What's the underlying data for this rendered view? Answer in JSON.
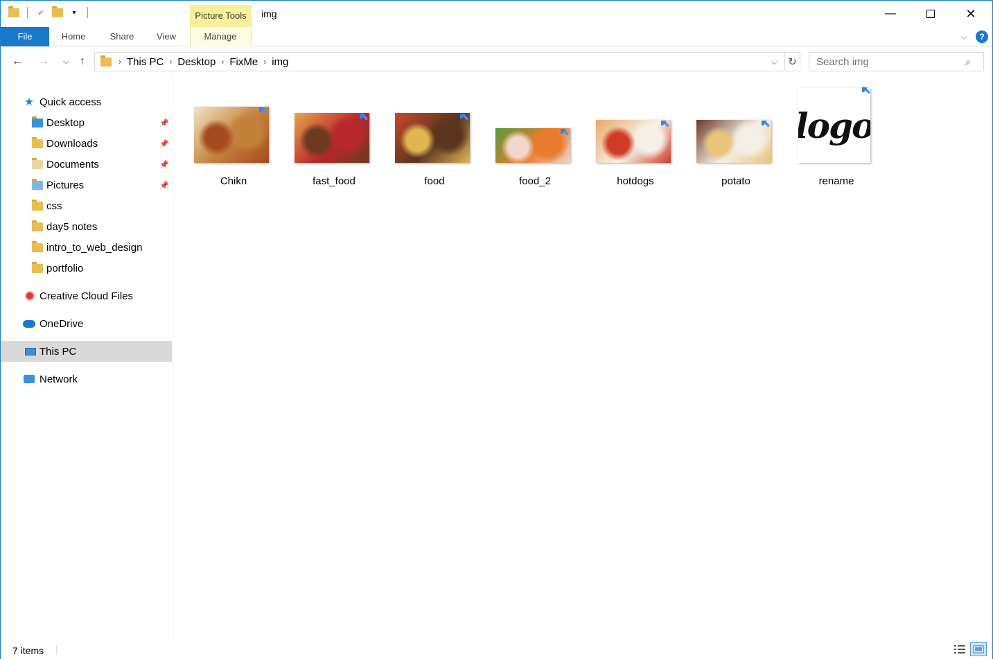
{
  "window": {
    "title": "img",
    "contextual_group": "Picture Tools",
    "minimize_icon": "minimize-icon",
    "maximize_icon": "maximize-icon",
    "close_icon": "close-icon"
  },
  "ribbon": {
    "tabs": [
      {
        "label": "File"
      },
      {
        "label": "Home"
      },
      {
        "label": "Share"
      },
      {
        "label": "View"
      },
      {
        "label": "Manage"
      }
    ]
  },
  "navigation": {
    "breadcrumb": [
      "This PC",
      "Desktop",
      "FixMe",
      "img"
    ],
    "search_placeholder": "Search img"
  },
  "sidebar": {
    "items": [
      {
        "label": "Quick access",
        "icon": "star-icon",
        "pinned": false
      },
      {
        "label": "Desktop",
        "icon": "folder-icon",
        "pinned": true
      },
      {
        "label": "Downloads",
        "icon": "downloads-folder-icon",
        "pinned": true
      },
      {
        "label": "Documents",
        "icon": "documents-folder-icon",
        "pinned": true
      },
      {
        "label": "Pictures",
        "icon": "pictures-folder-icon",
        "pinned": true
      },
      {
        "label": "css",
        "icon": "folder-icon",
        "pinned": false
      },
      {
        "label": "day5 notes",
        "icon": "folder-icon",
        "pinned": false
      },
      {
        "label": "intro_to_web_design",
        "icon": "folder-icon",
        "pinned": false
      },
      {
        "label": "portfolio",
        "icon": "folder-icon",
        "pinned": false
      },
      {
        "label": "Creative Cloud Files",
        "icon": "creative-cloud-icon",
        "pinned": false
      },
      {
        "label": "OneDrive",
        "icon": "onedrive-icon",
        "pinned": false
      },
      {
        "label": "This PC",
        "icon": "computer-icon",
        "selected": true
      },
      {
        "label": "Network",
        "icon": "network-icon",
        "pinned": false
      }
    ]
  },
  "files": [
    {
      "name": "Chikn",
      "colors": [
        "#c4813a",
        "#f2e4c8",
        "#a64a20"
      ]
    },
    {
      "name": "fast_food",
      "colors": [
        "#b8272b",
        "#e5a74d",
        "#6b3a1f"
      ]
    },
    {
      "name": "food",
      "colors": [
        "#5a3520",
        "#c94a2a",
        "#e1b650"
      ]
    },
    {
      "name": "food_2",
      "colors": [
        "#e87b2e",
        "#5b9a3a",
        "#f2d6c9"
      ]
    },
    {
      "name": "hotdogs",
      "colors": [
        "#f5f0e6",
        "#e8a96a",
        "#d13a26"
      ]
    },
    {
      "name": "potato",
      "colors": [
        "#f3efe7",
        "#6b3a22",
        "#e9c47a"
      ]
    },
    {
      "name": "rename",
      "colors": [
        "#ffffff",
        "#111111",
        "#7fd6e8"
      ],
      "logo_text": "logo"
    }
  ],
  "status": {
    "item_count": "7 items"
  }
}
